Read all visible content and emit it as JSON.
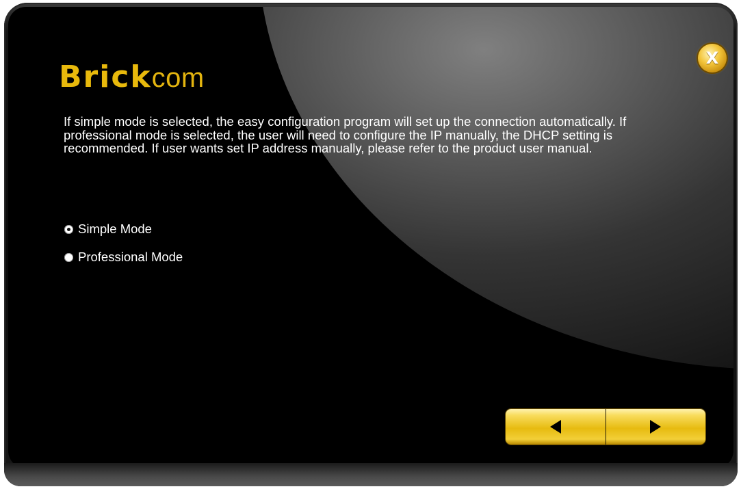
{
  "brand": {
    "name_strong": "Brick",
    "name_light": "com",
    "color": "#e8b90c"
  },
  "close_button": {
    "icon": "close-icon",
    "glyph": "X"
  },
  "description": "If simple mode is selected, the easy configuration program will set up the connection automatically. If professional mode is selected, the user will need to configure the IP manually, the DHCP setting is recommended. If user wants set IP address manually, please refer to the product user manual.",
  "modes": {
    "selected": "Simple Mode",
    "options": [
      {
        "label": "Simple Mode",
        "checked": true
      },
      {
        "label": "Professional Mode",
        "checked": false
      }
    ]
  },
  "navigation": {
    "back_icon": "arrow-left-icon",
    "next_icon": "arrow-right-icon",
    "accent": "#f2c526"
  }
}
